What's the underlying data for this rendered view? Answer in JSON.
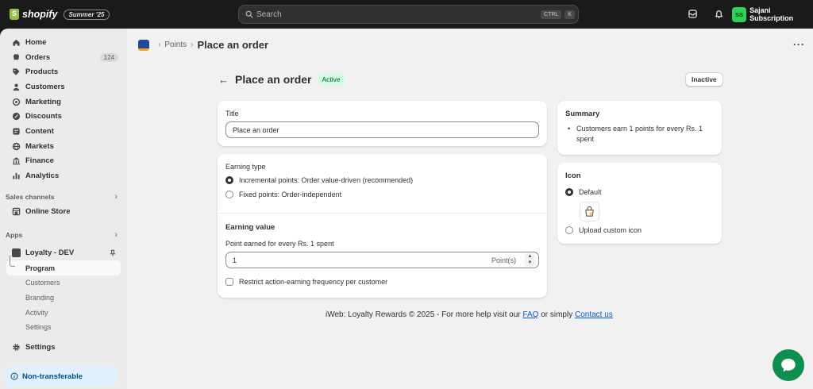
{
  "topbar": {
    "brand": "shopify",
    "edition_badge": "Summer '25",
    "search_placeholder": "Search",
    "shortcut_key1": "CTRL",
    "shortcut_key2": "K",
    "store_initials": "SS",
    "store_name": "Sajani Subscription"
  },
  "sidebar": {
    "items": [
      {
        "label": "Home",
        "icon": "home-icon"
      },
      {
        "label": "Orders",
        "icon": "orders-icon",
        "count": "124"
      },
      {
        "label": "Products",
        "icon": "tag-icon"
      },
      {
        "label": "Customers",
        "icon": "person-icon"
      },
      {
        "label": "Marketing",
        "icon": "target-icon"
      },
      {
        "label": "Discounts",
        "icon": "discount-icon"
      },
      {
        "label": "Content",
        "icon": "content-icon"
      },
      {
        "label": "Markets",
        "icon": "globe-icon"
      },
      {
        "label": "Finance",
        "icon": "bank-icon"
      },
      {
        "label": "Analytics",
        "icon": "chart-icon"
      }
    ],
    "sales_channels_title": "Sales channels",
    "online_store": "Online Store",
    "apps_title": "Apps",
    "app_name": "Loyalty - DEV",
    "app_subitems": [
      "Program",
      "Customers",
      "Branding",
      "Activity",
      "Settings"
    ],
    "settings": "Settings",
    "non_transferable": "Non-transferable"
  },
  "breadcrumb": {
    "parent": "Points",
    "current": "Place an order"
  },
  "page": {
    "title": "Place an order",
    "status": "Active",
    "toggle_button": "Inactive"
  },
  "title_card": {
    "label": "Title",
    "value": "Place an order"
  },
  "earning_type": {
    "label": "Earning type",
    "options": [
      "Incremental points: Order value-driven (recommended)",
      "Fixed points: Order-independent"
    ],
    "selected_index": 0
  },
  "earning_value": {
    "heading": "Earning value",
    "label": "Point earned for every Rs. 1 spent",
    "value": "1",
    "suffix": "Point(s)",
    "restrict_label": "Restrict action-earning frequency per customer"
  },
  "summary": {
    "heading": "Summary",
    "bullet_line1": "Customers earn 1 points for every Rs. 1",
    "bullet_line2": "spent"
  },
  "icon_card": {
    "heading": "Icon",
    "default_label": "Default",
    "upload_label": "Upload custom icon"
  },
  "footer": {
    "text_prefix": "iWeb: Loyalty Rewards © 2025 - For more help visit our",
    "faq": "FAQ",
    "middle": "or simply",
    "contact": "Contact us"
  },
  "colors": {
    "topbar_bg": "#1a1a1a",
    "active_badge_bg": "#cdfee1",
    "link": "#005bd3",
    "chat_bubble": "#0e8f4f",
    "store_avatar": "#30d158"
  }
}
